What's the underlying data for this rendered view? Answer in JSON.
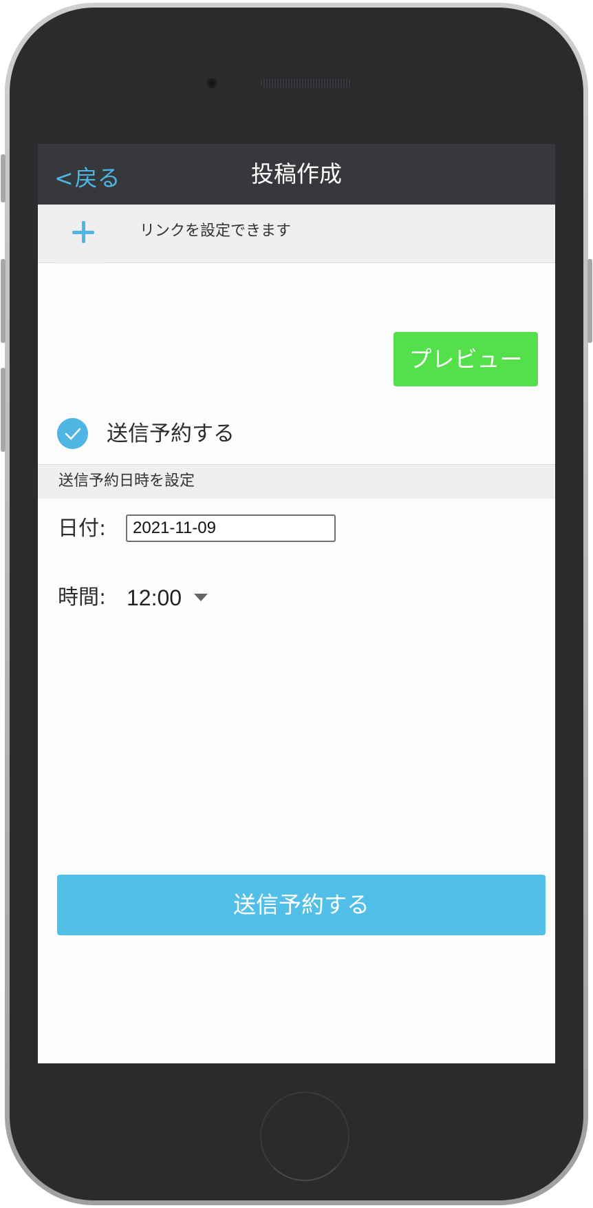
{
  "navbar": {
    "back_label": "戻る",
    "title": "投稿作成"
  },
  "link_bar": {
    "text": "リンクを設定できます"
  },
  "preview_button": "プレビュー",
  "schedule_toggle": {
    "label": "送信予約する",
    "checked": true
  },
  "schedule_section": {
    "header": "送信予約日時を設定",
    "date_label": "日付:",
    "date_value": "2021-11-09",
    "time_label": "時間:",
    "time_value": "12:00"
  },
  "submit_button": "送信予約する",
  "colors": {
    "accent": "#4fb5e3",
    "preview_green": "#54e04a",
    "submit_blue": "#52bfe8",
    "navbar": "#36383c"
  }
}
